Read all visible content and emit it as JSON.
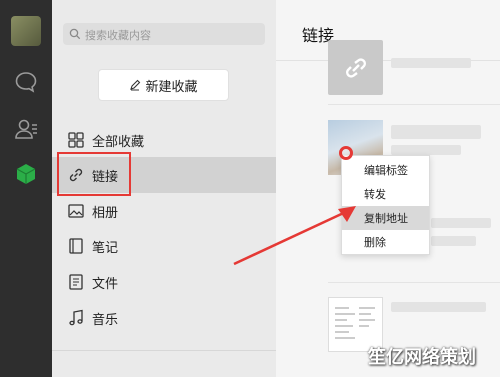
{
  "search": {
    "placeholder": "搜索收藏内容"
  },
  "sidebar": {
    "new_button": "新建收藏",
    "items": [
      {
        "label": "全部收藏",
        "icon": "grid-icon"
      },
      {
        "label": "链接",
        "icon": "link-icon",
        "active": true
      },
      {
        "label": "相册",
        "icon": "image-icon"
      },
      {
        "label": "笔记",
        "icon": "notebook-icon"
      },
      {
        "label": "文件",
        "icon": "file-icon"
      },
      {
        "label": "音乐",
        "icon": "music-note-icon"
      }
    ]
  },
  "main": {
    "title": "链接"
  },
  "context_menu": {
    "items": [
      "编辑标签",
      "转发",
      "复制地址",
      "删除"
    ],
    "highlighted": "复制地址"
  },
  "watermark": "笙亿网络策划",
  "colors": {
    "accent_red": "#e53935",
    "active_green": "#2bae48"
  }
}
